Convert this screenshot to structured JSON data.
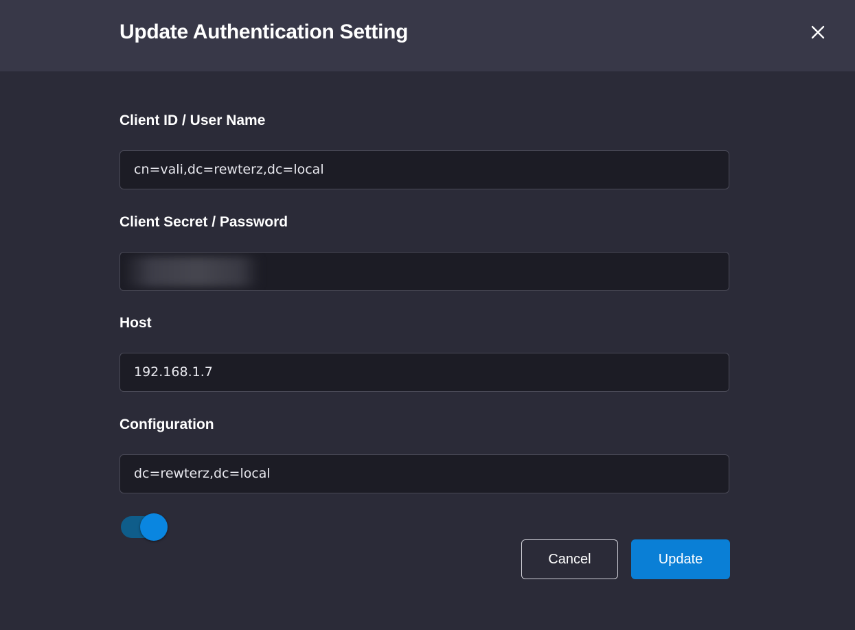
{
  "dialog": {
    "title": "Update Authentication Setting",
    "close_icon": "close-icon"
  },
  "fields": {
    "client_id": {
      "label": "Client ID / User Name",
      "value": "cn=vali,dc=rewterz,dc=local"
    },
    "client_secret": {
      "label": "Client Secret / Password",
      "value": ""
    },
    "host": {
      "label": "Host",
      "value": "192.168.1.7"
    },
    "configuration": {
      "label": "Configuration",
      "value": "dc=rewterz,dc=local"
    }
  },
  "toggle": {
    "state": "on",
    "color": "#0a86e0"
  },
  "buttons": {
    "cancel_label": "Cancel",
    "update_label": "Update"
  },
  "colors": {
    "accent": "#0a7fd6",
    "background": "#2b2b38",
    "header": "#383848"
  }
}
